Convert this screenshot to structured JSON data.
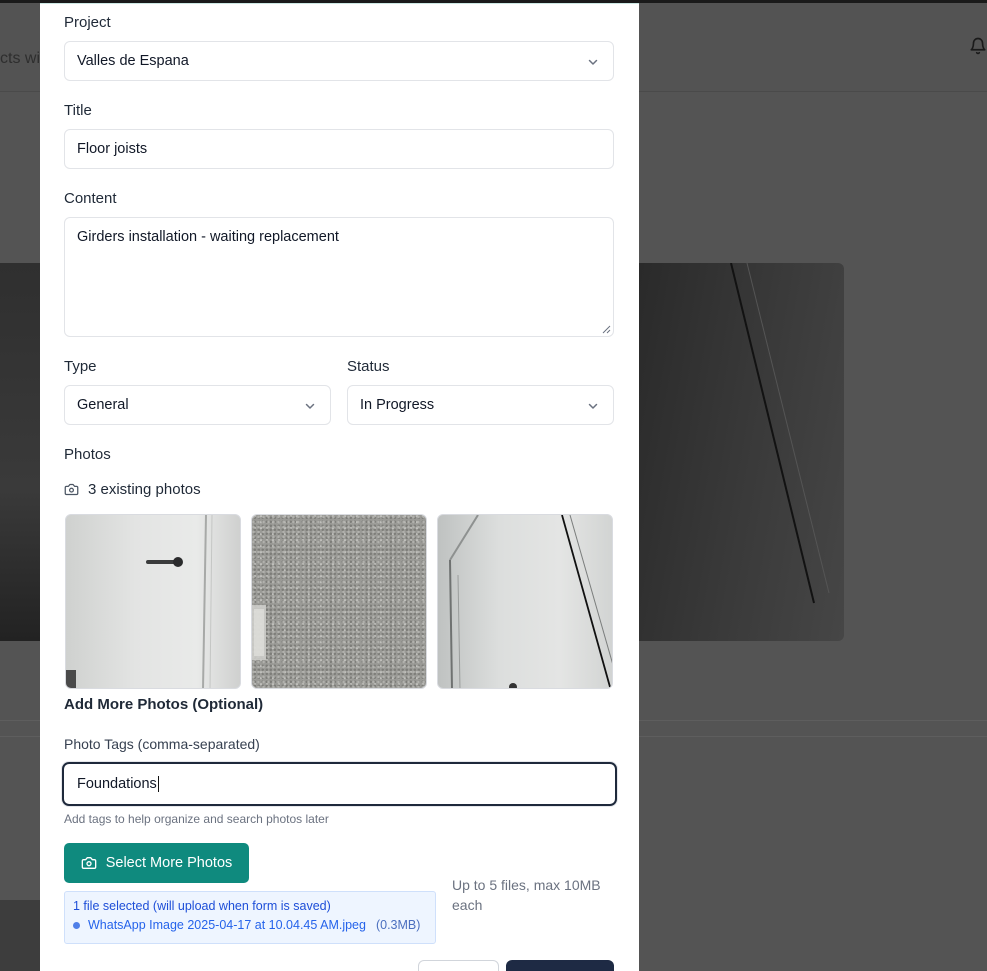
{
  "background": {
    "subtitle_fragment": "cts with"
  },
  "form": {
    "project": {
      "label": "Project",
      "value": "Valles de Espana"
    },
    "title": {
      "label": "Title",
      "value": "Floor joists"
    },
    "content": {
      "label": "Content",
      "value": "Girders installation - waiting replacement"
    },
    "type": {
      "label": "Type",
      "value": "General"
    },
    "status": {
      "label": "Status",
      "value": "In Progress"
    },
    "photos": {
      "label": "Photos",
      "existing_count_text": "3 existing photos",
      "add_more_label": "Add More Photos (Optional)"
    },
    "photo_tags": {
      "label": "Photo Tags (comma-separated)",
      "value": "Foundations",
      "hint": "Add tags to help organize and search photos later"
    },
    "select_button": {
      "label": "Select More Photos",
      "icon": "camera-icon"
    },
    "limit_text": "Up to 5 files, max 10MB each",
    "selected_files": {
      "title": "1 file selected (will upload when form is saved)",
      "files": [
        {
          "name": "WhatsApp Image 2025-04-17 at 10.04.45 AM.jpeg",
          "size": "(0.3MB)"
        }
      ]
    }
  },
  "colors": {
    "primary_button": "#0f8a7e",
    "focus_border": "#1e293b",
    "info_bg": "#eef5ff",
    "info_text": "#1d4ed8"
  }
}
